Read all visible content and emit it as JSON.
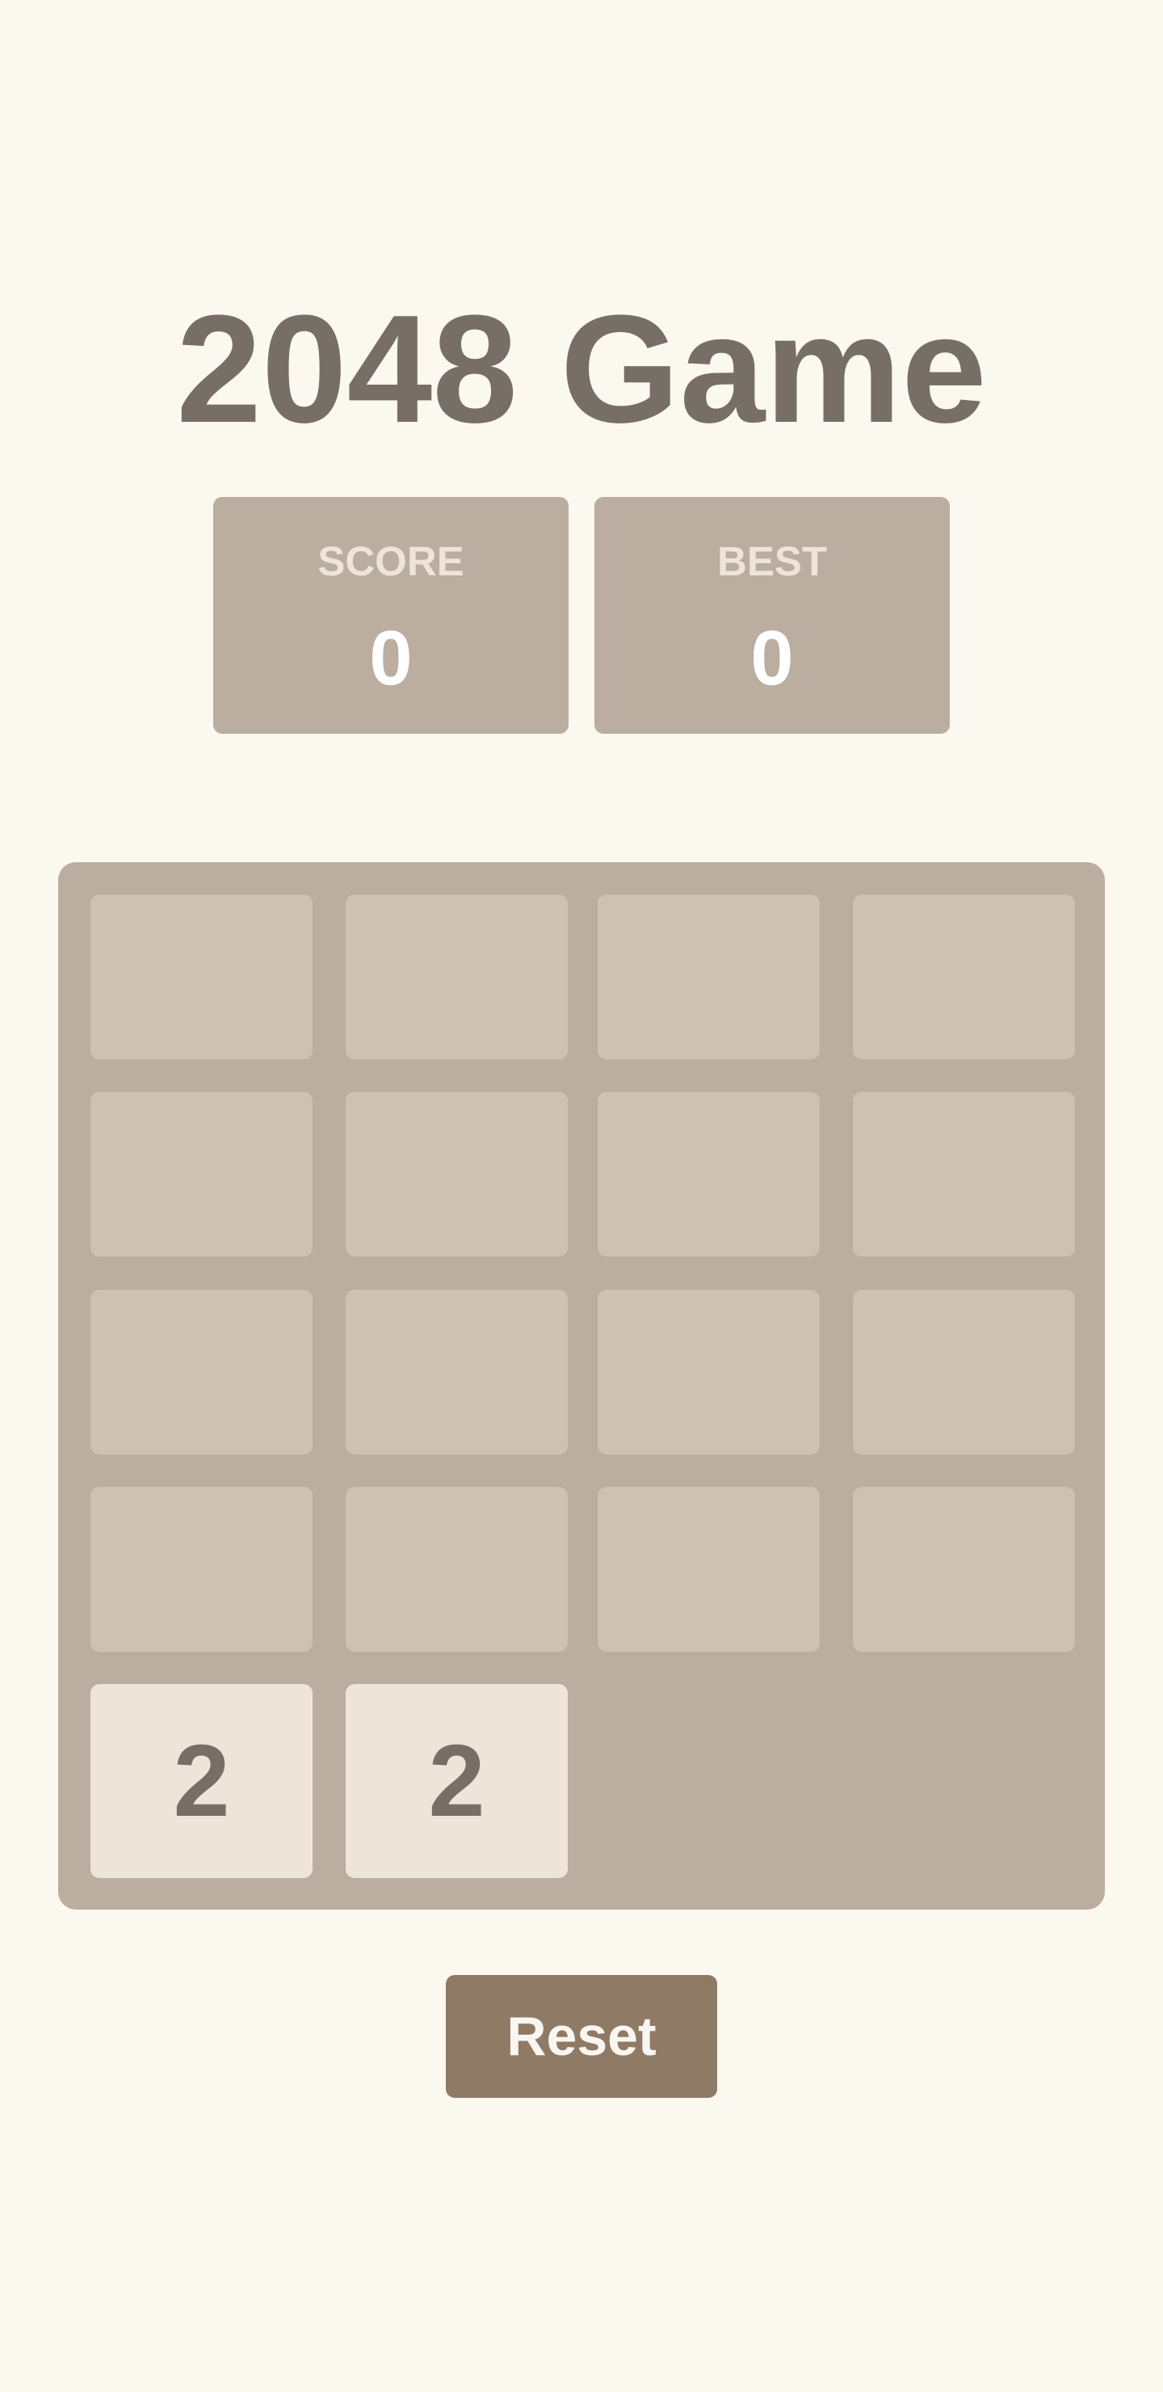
{
  "title": "2048 Game",
  "score": {
    "label": "SCORE",
    "value": "0"
  },
  "best": {
    "label": "BEST",
    "value": "0"
  },
  "board": {
    "rows": [
      [
        "",
        "",
        "",
        ""
      ],
      [
        "",
        "",
        "",
        ""
      ],
      [
        "",
        "",
        "",
        ""
      ],
      [
        "",
        "",
        "",
        ""
      ],
      [
        "2",
        "2"
      ]
    ]
  },
  "reset_label": "Reset",
  "colors": {
    "background": "#faf8ef",
    "title": "#776e65",
    "board": "#bbada0",
    "empty_cell": "#cdc1b4",
    "tile_2": "#eee4da",
    "button": "#8f7a66"
  }
}
